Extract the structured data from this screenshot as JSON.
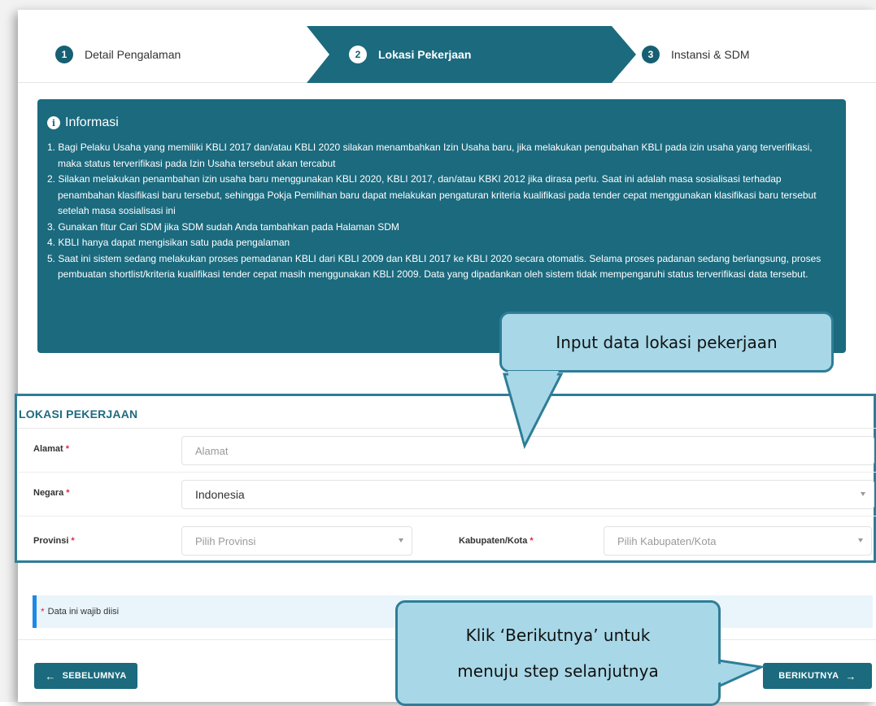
{
  "steps": [
    {
      "num": "1",
      "label": "Detail Pengalaman",
      "active": false
    },
    {
      "num": "2",
      "label": "Lokasi Pekerjaan",
      "active": true
    },
    {
      "num": "3",
      "label": "Instansi & SDM",
      "active": false
    }
  ],
  "info": {
    "title": "Informasi",
    "items": [
      "1. Bagi Pelaku Usaha yang memiliki KBLI 2017 dan/atau KBLI 2020 silakan menambahkan Izin Usaha baru, jika melakukan pengubahan KBLI pada izin usaha yang terverifikasi, maka status terverifikasi pada Izin Usaha tersebut akan tercabut",
      "2. Silakan melakukan penambahan izin usaha baru menggunakan KBLI 2020, KBLI 2017, dan/atau KBKI 2012 jika dirasa perlu. Saat ini adalah masa sosialisasi terhadap penambahan klasifikasi baru tersebut, sehingga Pokja Pemilihan baru dapat melakukan pengaturan kriteria kualifikasi pada tender cepat menggunakan klasifikasi baru tersebut setelah masa sosialisasi ini",
      "3. Gunakan fitur Cari SDM jika SDM sudah Anda tambahkan pada Halaman SDM",
      "4. KBLI hanya dapat mengisikan satu pada pengalaman",
      "5. Saat ini sistem sedang melakukan proses pemadanan KBLI dari KBLI 2009 dan KBLI 2017 ke KBLI 2020 secara otomatis. Selama proses padanan sedang berlangsung, proses pembuatan shortlist/kriteria kualifikasi tender cepat masih menggunakan KBLI 2009. Data yang dipadankan oleh sistem tidak mempengaruhi status terverifikasi data tersebut."
    ]
  },
  "callouts": {
    "input": "Input data lokasi pekerjaan",
    "next_line1": "Klik ‘Berikutnya’ untuk",
    "next_line2": "menuju step selanjutnya"
  },
  "section": {
    "title": "LOKASI PEKERJAAN",
    "alamat_label": "Alamat",
    "alamat_placeholder": "Alamat",
    "negara_label": "Negara",
    "negara_value": "Indonesia",
    "provinsi_label": "Provinsi",
    "provinsi_placeholder": "Pilih Provinsi",
    "kabupaten_label": "Kabupaten/Kota",
    "kabupaten_placeholder": "Pilih Kabupaten/Kota",
    "required_mark": "*"
  },
  "note": "Data ini wajib diisi",
  "buttons": {
    "prev": "SEBELUMNYA",
    "next": "BERIKUTNYA"
  },
  "colors": {
    "primary": "#1b6a7e",
    "callout_fill": "#a8d8e8",
    "callout_border": "#2e7d97",
    "required": "#e0284a"
  }
}
